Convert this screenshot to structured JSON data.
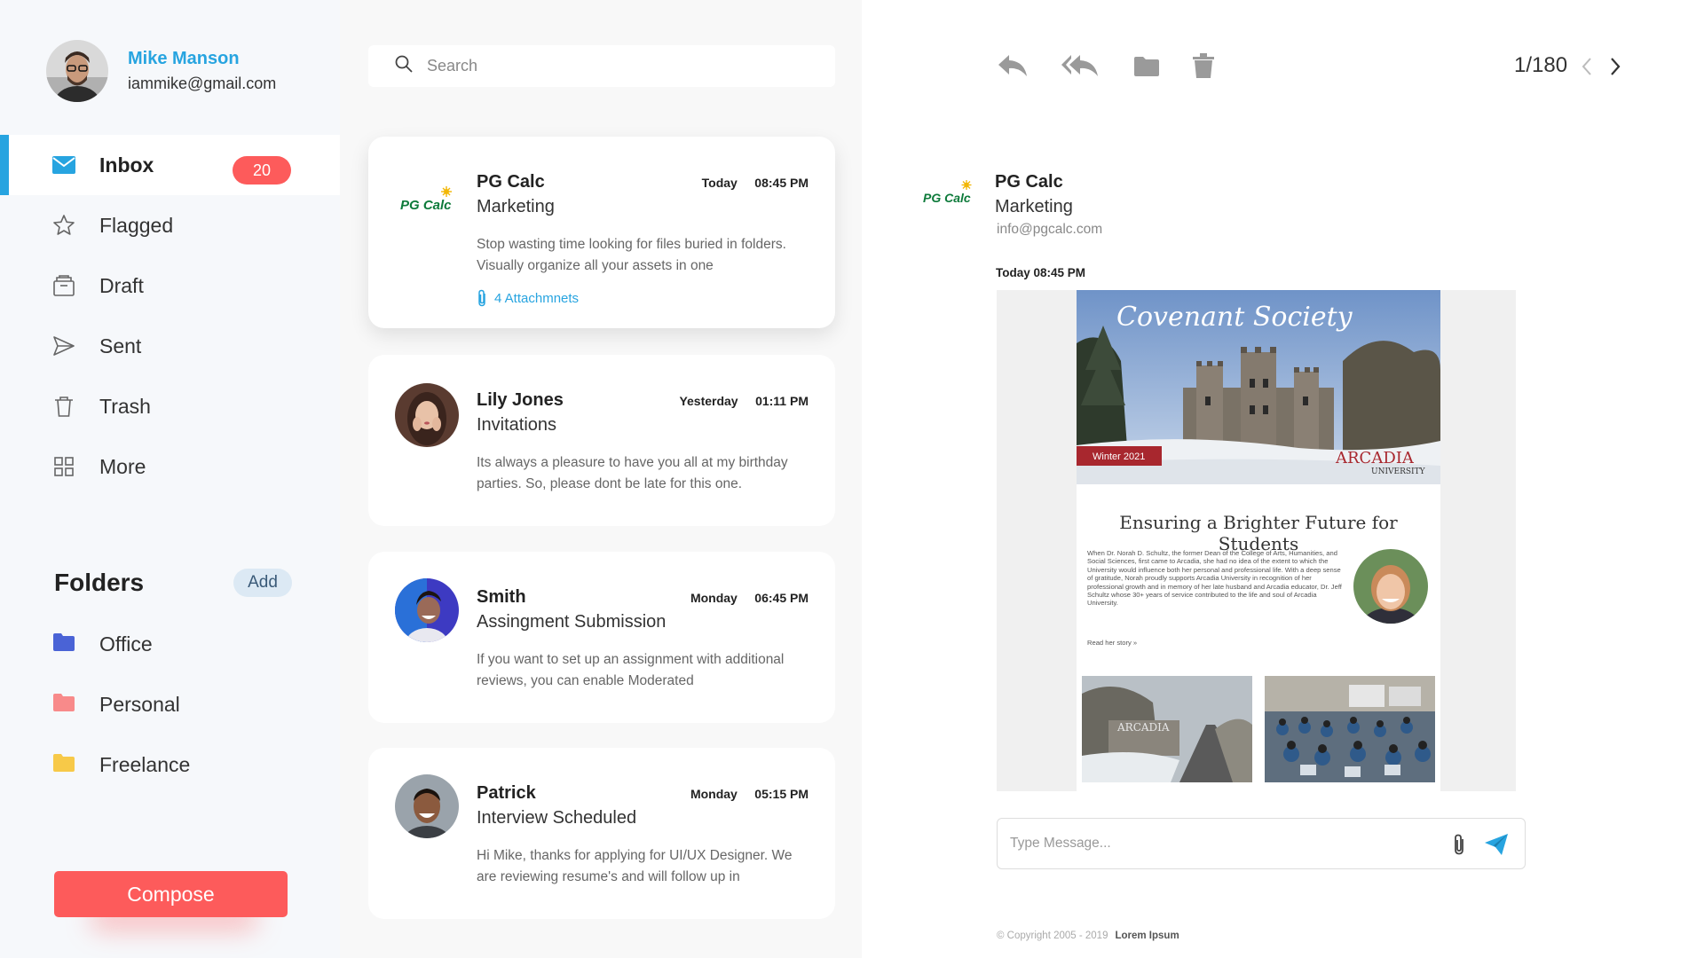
{
  "user": {
    "name": "Mike Manson",
    "email": "iammike@gmail.com"
  },
  "nav": [
    {
      "label": "Inbox",
      "icon": "envelope-icon",
      "badge": "20"
    },
    {
      "label": "Flagged",
      "icon": "star-icon"
    },
    {
      "label": "Draft",
      "icon": "draft-icon"
    },
    {
      "label": "Sent",
      "icon": "send-icon"
    },
    {
      "label": "Trash",
      "icon": "trash-icon"
    },
    {
      "label": "More",
      "icon": "grid-icon"
    }
  ],
  "folders": {
    "title": "Folders",
    "add_label": "Add",
    "items": [
      {
        "label": "Office",
        "color": "#4a63d6"
      },
      {
        "label": "Personal",
        "color": "#f88a8a"
      },
      {
        "label": "Freelance",
        "color": "#f7c948"
      }
    ]
  },
  "compose_label": "Compose",
  "search": {
    "placeholder": "Search"
  },
  "messages": [
    {
      "sender": "PG Calc",
      "subject": "Marketing",
      "day": "Today",
      "time": "08:45 PM",
      "preview": "Stop wasting time looking for files buried in folders. Visually organize all your assets in one",
      "attachments": "4 Attachmnets",
      "logo_text": "PG Calc"
    },
    {
      "sender": "Lily Jones",
      "subject": "Invitations",
      "day": "Yesterday",
      "time": "01:11 PM",
      "preview": "Its always a pleasure to have you all at my birthday parties. So, please dont be late for this one."
    },
    {
      "sender": "Smith",
      "subject": "Assingment Submission",
      "day": "Monday",
      "time": "06:45 PM",
      "preview": "If you want to set up an assignment with additional reviews, you can enable Moderated"
    },
    {
      "sender": "Patrick",
      "subject": "Interview Scheduled",
      "day": "Monday",
      "time": "05:15 PM",
      "preview": " Hi Mike, thanks for applying for UI/UX Designer. We are reviewing resume's and will follow up in"
    }
  ],
  "reader": {
    "pager": "1/180",
    "logo_text": "PG Calc",
    "sender": "PG Calc",
    "subject": "Marketing",
    "email": "info@pgcalc.com",
    "date": "Today 08:45 PM",
    "newsletter": {
      "script_title": "Covenant Society",
      "edition": "Winter 2021",
      "brand": "ARCADIA",
      "brand_sub": "UNIVERSITY",
      "headline": "Ensuring a Brighter Future for Students",
      "body": "When Dr. Norah D. Schultz, the former Dean of the College of Arts, Humanities, and Social Sciences, first came to Arcadia, she had no idea of the extent to which the University would influence both her personal and professional life. With a deep sense of gratitude, Norah proudly supports Arcadia University in recognition of her professional growth and in memory of her late husband and Arcadia educator, Dr. Jeff Schultz whose 30+ years of service contributed to the life and soul of Arcadia University.",
      "read_more": "Read her story »",
      "sign_text": "ARCADIA"
    },
    "reply_placeholder": "Type Message...",
    "footer_copy": "© Copyright 2005 - 2019",
    "footer_brand": "Lorem Ipsum"
  },
  "colors": {
    "accent": "#27a4e0",
    "danger": "#fd5b5b",
    "logo_green": "#0d7a3a",
    "logo_sun": "#f2b705"
  }
}
